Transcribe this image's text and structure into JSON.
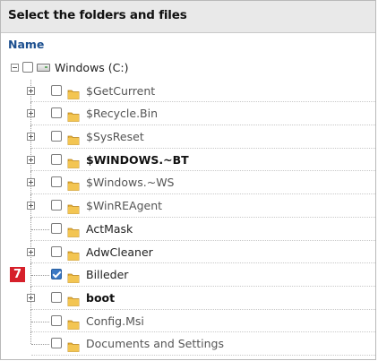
{
  "dialog": {
    "title": "Select the folders and files"
  },
  "tree": {
    "column_header": "Name",
    "root": {
      "label": "Windows (C:)",
      "expanded": true,
      "checked": false,
      "icon": "drive-icon"
    },
    "items": [
      {
        "label": "$GetCurrent",
        "expandable": true,
        "checked": false,
        "style": "dim"
      },
      {
        "label": "$Recycle.Bin",
        "expandable": true,
        "checked": false,
        "style": "dim"
      },
      {
        "label": "$SysReset",
        "expandable": true,
        "checked": false,
        "style": "dim"
      },
      {
        "label": "$WINDOWS.~BT",
        "expandable": true,
        "checked": false,
        "style": "bold"
      },
      {
        "label": "$Windows.~WS",
        "expandable": true,
        "checked": false,
        "style": "dim"
      },
      {
        "label": "$WinREAgent",
        "expandable": true,
        "checked": false,
        "style": "dim"
      },
      {
        "label": "ActMask",
        "expandable": false,
        "checked": false,
        "style": "normal"
      },
      {
        "label": "AdwCleaner",
        "expandable": true,
        "checked": false,
        "style": "normal"
      },
      {
        "label": "Billeder",
        "expandable": false,
        "checked": true,
        "style": "normal",
        "badge": "7"
      },
      {
        "label": "boot",
        "expandable": true,
        "checked": false,
        "style": "bold"
      },
      {
        "label": "Config.Msi",
        "expandable": false,
        "checked": false,
        "style": "dim"
      },
      {
        "label": "Documents and Settings",
        "expandable": false,
        "checked": false,
        "style": "dim"
      }
    ]
  },
  "colors": {
    "accent": "#3a78c4",
    "badge": "#d6202a",
    "folder": "#e8b33a"
  }
}
